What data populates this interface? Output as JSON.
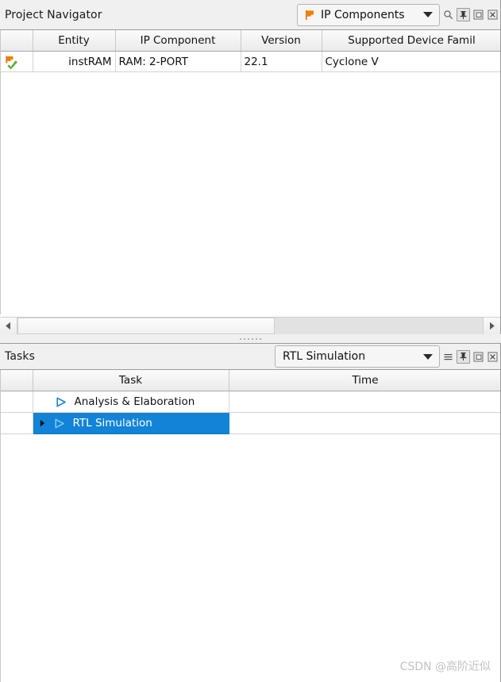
{
  "project_navigator": {
    "title": "Project Navigator",
    "view_selector": {
      "value": "IP Components",
      "icon": "flag-icon"
    },
    "titlebar_icons": [
      {
        "name": "search-icon",
        "active": false
      },
      {
        "name": "pin-icon",
        "active": true
      },
      {
        "name": "restore-icon",
        "active": false
      },
      {
        "name": "close-icon",
        "active": false
      }
    ],
    "table": {
      "columns": [
        "",
        "Entity",
        "IP Component",
        "Version",
        "Supported Device Famil"
      ],
      "rows": [
        {
          "status_icon": "flag-check-icon",
          "entity": "instRAM",
          "ip_component": "RAM: 2-PORT",
          "version": "22.1",
          "device_family": "Cyclone V"
        }
      ]
    },
    "hscrollbar": {
      "left_arrow": "scroll-left-icon",
      "right_arrow": "scroll-right-icon"
    }
  },
  "splitter": {
    "name": "panel-splitter"
  },
  "tasks": {
    "title": "Tasks",
    "flow_selector": {
      "value": "RTL Simulation"
    },
    "titlebar_icons": [
      {
        "name": "menu-icon",
        "active": false
      },
      {
        "name": "pin-icon",
        "active": true
      },
      {
        "name": "restore-icon",
        "active": false
      },
      {
        "name": "close-icon",
        "active": false
      }
    ],
    "table": {
      "columns": [
        "",
        "Task",
        "Time"
      ],
      "rows": [
        {
          "label": "Analysis & Elaboration",
          "time": "",
          "selected": false,
          "expandable": false
        },
        {
          "label": "RTL Simulation",
          "time": "",
          "selected": true,
          "expandable": true
        }
      ]
    }
  },
  "watermark": "CSDN @高阶近似",
  "colors": {
    "selection_blue": "#1283d6",
    "run_triangle_blue": "#1484d8",
    "flag_orange": "#f08000",
    "check_green": "#4aa32a",
    "panel_bg": "#f0f0f0"
  }
}
